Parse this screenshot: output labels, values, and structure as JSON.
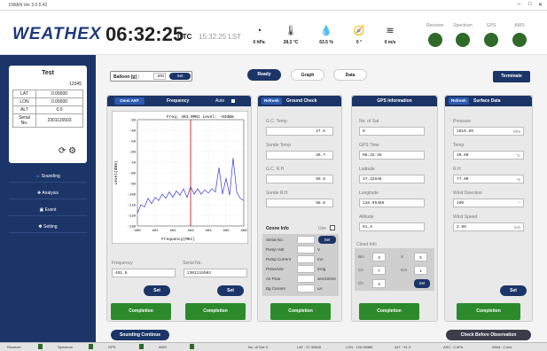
{
  "window": {
    "title": "DWAN Ver 3.0.5.42",
    "min": "–",
    "max": "□",
    "close": "✕"
  },
  "header": {
    "logo": "WEATHEX",
    "time": "06:32:25",
    "utc": "UTC",
    "lst": "15:32:25 LST",
    "weather": [
      {
        "icon": "gauge-icon",
        "glyph": "◔",
        "value": "0 hPa"
      },
      {
        "icon": "thermometer-icon",
        "glyph": "🌡",
        "value": "28.2 °C"
      },
      {
        "icon": "humidity-icon",
        "glyph": "💧",
        "value": "63.5 %"
      },
      {
        "icon": "compass-icon",
        "glyph": "🧭",
        "value": "0 °"
      },
      {
        "icon": "wind-icon",
        "glyph": "≋",
        "value": "0 m/s"
      }
    ],
    "status": [
      {
        "label": "Receiver"
      },
      {
        "label": "Spectrum"
      },
      {
        "label": "GPS"
      },
      {
        "label": "AWS"
      }
    ]
  },
  "station": {
    "name": "Test",
    "id": "12345",
    "rows": [
      {
        "k": "LAT",
        "v": "0.00000"
      },
      {
        "k": "LON",
        "v": "0.00000"
      },
      {
        "k": "ALT",
        "v": "0.0"
      },
      {
        "k": "Serial No.",
        "v": "2301115503"
      }
    ]
  },
  "menu": [
    {
      "label": "⇔ Sounding"
    },
    {
      "label": "✚ Analysis"
    },
    {
      "label": "▣ Event"
    },
    {
      "label": "✽ Setting"
    }
  ],
  "toolbar": {
    "balloon_label": "Balloon [g] :",
    "balloon_value": "500",
    "set": "Set",
    "ready": "Ready",
    "graph": "Graph",
    "data": "Data",
    "terminate": "Terminate"
  },
  "frequency": {
    "omni": "Omni ANT",
    "title": "Frequency",
    "auto": "Auto",
    "chart_caption": "Freq: 403.0MHz  Level: -93dBm",
    "freq_label": "Frequency",
    "freq_value": "401.5",
    "serial_label": "Serial No.",
    "serial_value": "2301115503",
    "set1": "Set",
    "set2": "Set",
    "completion": "Completion"
  },
  "ground": {
    "refresh": "Refresh",
    "title": "Ground Check",
    "items": [
      {
        "label": "G.C. Temp",
        "value": "27.5"
      },
      {
        "label": "Sonde Temp",
        "value": "26.7"
      },
      {
        "label": "G.C. R.H",
        "value": "69.8"
      },
      {
        "label": "Sonde R.H",
        "value": "68.8"
      }
    ],
    "completion": "Completion"
  },
  "ozone": {
    "title": "Ozone Info",
    "use": "Use",
    "set": "Set",
    "rows": [
      {
        "label": "Serial No.",
        "unit": ""
      },
      {
        "label": "Pump Volt",
        "unit": "V"
      },
      {
        "label": "Pump Current",
        "unit": "mA"
      },
      {
        "label": "Press/Vac",
        "unit": "inHg"
      },
      {
        "label": "Air Flow",
        "unit": "sec/100ml"
      },
      {
        "label": "Bg Current",
        "unit": "uA"
      }
    ]
  },
  "gps": {
    "title": "GPS Information",
    "items": [
      {
        "label": "No. of Sat",
        "value": "0"
      },
      {
        "label": "GPS Time",
        "value": "06:32:26"
      },
      {
        "label": "Latitude",
        "value": "37.32848"
      },
      {
        "label": "Longitude",
        "value": "126.95486"
      },
      {
        "label": "Altitude",
        "value": "91.3"
      }
    ],
    "cloud": "Cloud Info",
    "c": [
      {
        "l": "Bm",
        "v": "3"
      },
      {
        "l": "X",
        "v": "5"
      },
      {
        "l": "C2",
        "v": "7"
      },
      {
        "l": "Cm",
        "v": "1"
      },
      {
        "l": "Ch",
        "v": "3"
      }
    ],
    "set": "Set",
    "completion": "Completion"
  },
  "surface": {
    "refresh": "Refresh",
    "title": "Surface Data",
    "items": [
      {
        "label": "Pressure",
        "value": "1010.60",
        "unit": "hPa"
      },
      {
        "label": "Temp",
        "value": "30.00",
        "unit": "°C"
      },
      {
        "label": "R.H",
        "value": "77.00",
        "unit": "%"
      },
      {
        "label": "Wind Direction",
        "value": "190",
        "unit": "°"
      },
      {
        "label": "Wind Speed",
        "value": "2.90",
        "unit": "m/s"
      }
    ],
    "set": "Set",
    "completion": "Completion"
  },
  "footer": {
    "sounding_continue": "Sounding Continue",
    "check": "Check Before Observation"
  },
  "statusbar": [
    "Receiver",
    "Spectrum",
    "GPS",
    "AWS",
    "No. of Sat: 0",
    "LAT : 37.32848",
    "LON : 126.95486",
    "ALT : 91.3",
    "ASC : 0 hPa",
    "Wind : 0 m/s"
  ],
  "chart_data": {
    "type": "line",
    "title": "Freq: 403.0MHz  Level: -93dBm",
    "xlabel": "Frequency(MHz)",
    "ylabel": "Level(dBm)",
    "xlim": [
      400,
      406
    ],
    "ylim": [
      -130,
      -30
    ],
    "xticks": [
      "400",
      "401",
      "402",
      "403",
      "404",
      "405",
      "406"
    ],
    "yticks": [
      "-30",
      "-40",
      "-50",
      "-60",
      "-70",
      "-80",
      "-90",
      "-100",
      "-110",
      "-120",
      "-130"
    ],
    "marker_x": 403.0,
    "x": [
      400.0,
      400.2,
      400.4,
      400.6,
      400.8,
      401.0,
      401.2,
      401.4,
      401.6,
      401.8,
      402.0,
      402.2,
      402.4,
      402.6,
      402.8,
      403.0,
      403.2,
      403.4,
      403.6,
      403.8,
      404.0,
      404.2,
      404.4,
      404.6,
      404.8,
      405.0,
      405.2,
      405.4,
      405.6,
      405.8,
      406.0
    ],
    "values": [
      -118,
      -110,
      -112,
      -104,
      -109,
      -103,
      -106,
      -100,
      -104,
      -98,
      -103,
      -97,
      -101,
      -95,
      -103,
      -93,
      -100,
      -95,
      -100,
      -96,
      -99,
      -95,
      -98,
      -75,
      -100,
      -85,
      -101,
      -66,
      -98,
      -104,
      -106
    ]
  }
}
